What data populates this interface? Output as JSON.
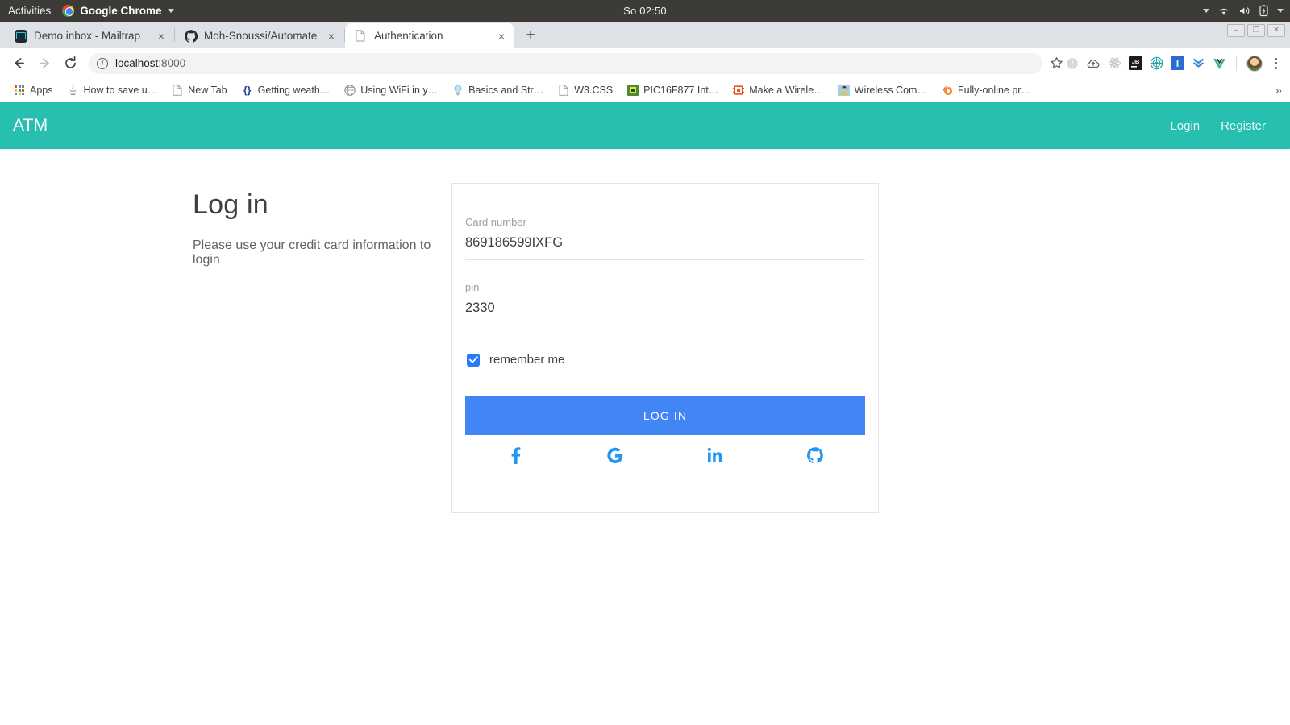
{
  "os_bar": {
    "activities": "Activities",
    "app_name": "Google Chrome",
    "clock": "So 02:50",
    "icons": [
      "chevron-down-icon",
      "wifi-icon",
      "volume-icon",
      "battery-icon",
      "system-menu-chevron-icon"
    ]
  },
  "window_controls": {
    "minimize": "–",
    "maximize": "❐",
    "close": "✕"
  },
  "browser": {
    "tabs": [
      {
        "title": "Demo inbox - Mailtrap",
        "favicon": "mailtrap-icon",
        "active": false,
        "close": "×"
      },
      {
        "title": "Moh-Snoussi/Automated",
        "favicon": "github-icon",
        "active": false,
        "close": "×"
      },
      {
        "title": "Authentication",
        "favicon": "page-icon",
        "active": true,
        "close": "×"
      }
    ],
    "new_tab_label": "+",
    "nav": {
      "back": "←",
      "forward": "→",
      "reload": "⟳"
    },
    "omnibox": {
      "host": "localhost",
      "port": ":8000",
      "security_icon": "info-circle-icon",
      "bookmark_icon": "star-icon"
    },
    "extensions": [
      {
        "name": "warning-extension-icon",
        "glyph": "!",
        "color": "#c6c8ca"
      },
      {
        "name": "cloud-extension-icon",
        "glyph": "☁",
        "color": "#5f6368"
      },
      {
        "name": "react-devtools-icon",
        "glyph": "⚛",
        "color": "#c6c8ca"
      },
      {
        "name": "jetbrains-extension-icon",
        "glyph": "JB",
        "color": "#ffffff"
      },
      {
        "name": "globe-extension-icon",
        "glyph": "◌",
        "color": "#1aa6a6"
      },
      {
        "name": "intellij-extension-icon",
        "glyph": "I",
        "color": "#ffffff"
      },
      {
        "name": "chevrons-extension-icon",
        "glyph": "»",
        "color": "#3a8dde"
      },
      {
        "name": "vue-devtools-icon",
        "glyph": "V",
        "color": "#41b883"
      }
    ],
    "profile_avatar": "avatar",
    "menu_icon": "kebab-menu-icon",
    "bookmarks": [
      {
        "label": "Apps",
        "icon": "apps-grid-icon"
      },
      {
        "label": "How to save u…",
        "icon": "java-icon"
      },
      {
        "label": "New Tab",
        "icon": "page-icon"
      },
      {
        "label": "Getting weath…",
        "icon": "json-braces-icon"
      },
      {
        "label": "Using WiFi in y…",
        "icon": "globe-icon"
      },
      {
        "label": "Basics and Str…",
        "icon": "lightbulb-icon"
      },
      {
        "label": "W3.CSS",
        "icon": "page-icon"
      },
      {
        "label": "PIC16F877 Int…",
        "icon": "chip-green-icon"
      },
      {
        "label": "Make a Wirele…",
        "icon": "chip-orange-icon"
      },
      {
        "label": "Wireless Com…",
        "icon": "person-icon"
      },
      {
        "label": "Fully-online pr…",
        "icon": "flame-icon"
      }
    ],
    "bookmarks_overflow": "»"
  },
  "app": {
    "navbar": {
      "brand": "ATM",
      "links": [
        {
          "label": "Login"
        },
        {
          "label": "Register"
        }
      ],
      "color": "#26bfb0"
    },
    "heading": "Log in",
    "subheading": "Please use your credit card information to login",
    "form": {
      "fields": [
        {
          "label": "Card number",
          "value": "869186599IXFG"
        },
        {
          "label": "pin",
          "value": "2330"
        }
      ],
      "remember_me": {
        "label": "remember me",
        "checked": true,
        "color": "#2979ff"
      },
      "submit_label": "LOG IN",
      "submit_color": "#4285f4",
      "social_links": [
        {
          "name": "facebook-icon"
        },
        {
          "name": "google-icon"
        },
        {
          "name": "linkedin-icon"
        },
        {
          "name": "github-icon"
        }
      ],
      "social_color": "#2196f3"
    }
  }
}
